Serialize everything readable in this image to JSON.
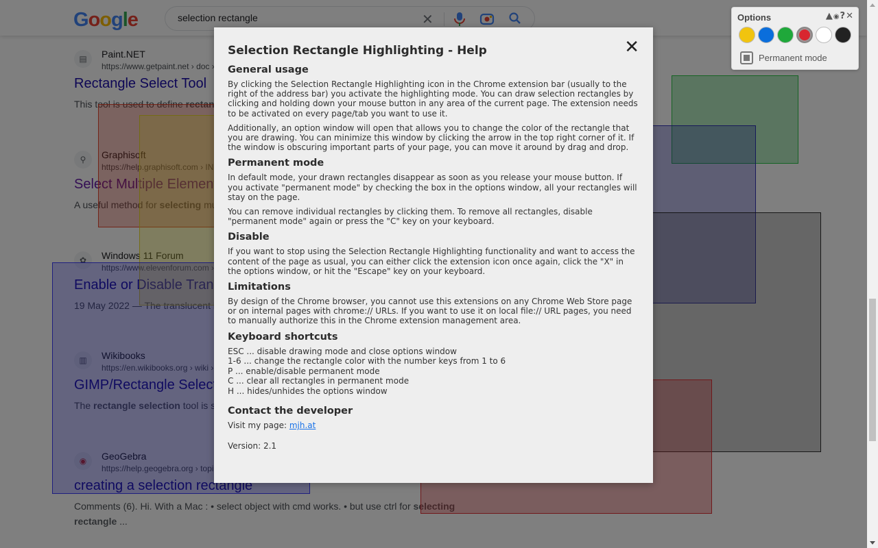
{
  "search": {
    "query": "selection rectangle",
    "logo": [
      "G",
      "o",
      "o",
      "g",
      "l",
      "e"
    ],
    "logo_colors": [
      "#4285f4",
      "#ea4335",
      "#fbbc05",
      "#4285f4",
      "#34a853",
      "#ea4335"
    ]
  },
  "results": [
    {
      "site": "Paint.NET",
      "url": "https://www.getpaint.net › doc ›",
      "title": "Rectangle Select Tool",
      "snippet_html": "This tool is used to define <b>rectangular</b> ... create a <b>selection</b>. ... The initial c",
      "icon": "paintnet-icon",
      "visited": false
    },
    {
      "site": "Graphisoft",
      "url": "https://help.graphisoft.com › IN",
      "title": "Select Multiple Elements",
      "snippet_html": "A useful method for <b>selecting</b> mu around the items. These will be e",
      "icon": "graphisoft-icon",
      "visited": true
    },
    {
      "site": "Windows 11 Forum",
      "url": "https://www.elevenforum.com ›",
      "title": "Enable or Disable Trans",
      "snippet_html": "19 May 2022 — The translucent hold, and then drag the pointer o",
      "icon": "windows-forum-icon",
      "visited": false
    },
    {
      "site": "Wikibooks",
      "url": "https://en.wikibooks.org › wiki ›",
      "title": "GIMP/Rectangle Select",
      "snippet_html": "The <b>rectangle selection</b> tool is selections. ... Expand from centre",
      "icon": "wikibooks-icon",
      "visited": false
    },
    {
      "site": "GeoGebra",
      "url": "https://help.geogebra.org › topi",
      "title": "creating a selection rectangle",
      "snippet_html": "Comments (6). Hi. With a Mac : • select object with cmd works. • but use ctrl for <b>selecting rectangle</b> ...",
      "icon": "geogebra-icon",
      "visited": false
    }
  ],
  "help": {
    "title": "Selection Rectangle Highlighting - Help",
    "close_label": "✕",
    "sections": {
      "general_heading": "General usage",
      "general_p1": "By clicking the Selection Rectangle Highlighting icon in the Chrome extension bar (usually to the right of the address bar) you activate the highlighting mode. You can draw selection rectangles by clicking and holding down your mouse button in any area of the current page. The extension needs to be activated on every page/tab you want to use it.",
      "general_p2": "Additionally, an option window will open that allows you to change the color of the rectangle that you are drawing. You can minimize this window by clicking the arrow in the top right corner of it. If the window is obscuring important parts of your page, you can move it around by drag and drop.",
      "permanent_heading": "Permanent mode",
      "permanent_p1": "In default mode, your drawn rectangles disappear as soon as you release your mouse button. If you activate \"permanent mode\" by checking the box in the options window, all your rectangles will stay on the page.",
      "permanent_p2": "You can remove individual rectangles by clicking them. To remove all rectangles, disable \"permanent mode\" again or press the \"C\" key on your keyboard.",
      "disable_heading": "Disable",
      "disable_p1": "If you want to stop using the Selection Rectangle Highlighting functionality and want to access the content of the page as usual, you can either click the extension icon once again, click the \"X\" in the options window, or hit the \"Escape\" key on your keyboard.",
      "limitations_heading": "Limitations",
      "limitations_p1": "By design of the Chrome browser, you cannot use this extensions on any Chrome Web Store page or on internal pages with chrome:// URLs. If you want to use it on local file:// URL pages, you need to manually authorize this in the Chrome extension management area.",
      "shortcuts_heading": "Keyboard shortcuts",
      "shortcuts": [
        "ESC ... disable drawing mode and close options window",
        "1-6 ... change the rectangle color with the number keys from 1 to 6",
        "P ... enable/disable permanent mode",
        "C ... clear all rectangles in permanent mode",
        "H ... hides/unhides the options window"
      ],
      "contact_heading": "Contact the developer",
      "contact_prefix": "Visit my page: ",
      "contact_link": "mjh.at",
      "version": "Version: 2.1"
    }
  },
  "options": {
    "title": "Options",
    "controls": "▲👁?✕",
    "colors": [
      "#f1c40f",
      "#0a6edc",
      "#1fa83a",
      "#d8262f",
      "#ffffff",
      "#222222"
    ],
    "selected_color_index": 3,
    "permanent_label": "Permanent mode",
    "permanent_checked": true
  },
  "rectangles": [
    {
      "color": "#e3371f"
    },
    {
      "color": "#ffee2a"
    },
    {
      "color": "#2d2dff"
    },
    {
      "color": "#19c23a"
    },
    {
      "color": "#2323b4"
    },
    {
      "color": "#383838"
    },
    {
      "color": "#e0282e"
    }
  ]
}
